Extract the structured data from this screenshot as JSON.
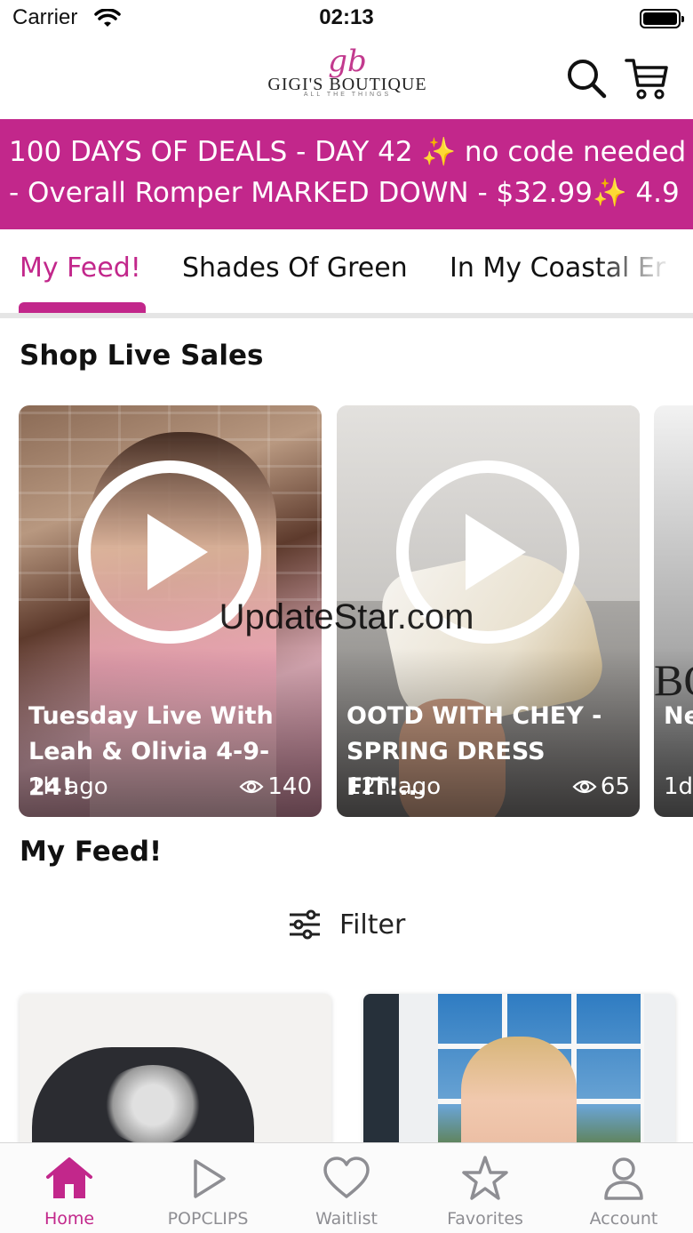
{
  "status_bar": {
    "carrier": "Carrier",
    "time": "02:13"
  },
  "header": {
    "logo_mark": "gb",
    "logo_text": "GIGI'S BOUTIQUE",
    "logo_sub": "ALL THE THINGS"
  },
  "banner": {
    "line1_a": "100 DAYS OF DEALS - DAY 42 ",
    "line1_sparkle": "✨",
    "line1_b": " no code needed",
    "line2_a": "- Overall Romper MARKED DOWN - $32.99",
    "line2_sparkle": "✨",
    "line2_b": " 4.9"
  },
  "tabs": [
    {
      "label": "My Feed!",
      "active": true
    },
    {
      "label": "Shades Of Green",
      "active": false
    },
    {
      "label": "In My Coastal Er",
      "active": false
    }
  ],
  "live_section": {
    "title": "Shop Live Sales",
    "cards": [
      {
        "title": "Tuesday Live With Leah & Olivia 4-9-24!",
        "time": "1h ago",
        "views": "140"
      },
      {
        "title": "OOTD WITH CHEY - SPRING DRESS FIT!...",
        "time": "12h ago",
        "views": "65"
      },
      {
        "title": "Ne Mi",
        "time": "1d",
        "logo": "BO"
      }
    ]
  },
  "watermark": "UpdateStar.com",
  "feed_section": {
    "title": "My Feed!",
    "filter_label": "Filter"
  },
  "bottom_nav": [
    {
      "label": "Home",
      "icon": "home-icon",
      "active": true
    },
    {
      "label": "POPCLIPS",
      "icon": "play-icon",
      "active": false
    },
    {
      "label": "Waitlist",
      "icon": "heart-icon",
      "active": false
    },
    {
      "label": "Favorites",
      "icon": "star-icon",
      "active": false
    },
    {
      "label": "Account",
      "icon": "person-icon",
      "active": false
    }
  ],
  "colors": {
    "brand": "#c2278b",
    "inactive": "#8e8e93"
  }
}
